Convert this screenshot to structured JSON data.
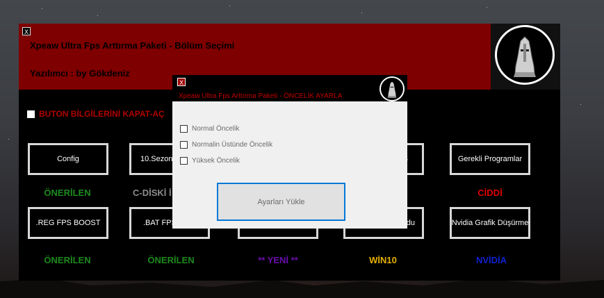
{
  "main_window": {
    "close_label": "X",
    "title": "Xpeaw Ultra Fps Arttırma Paketi - Bölüm Seçimi",
    "author": "Yazılımcı : by Gökdeniz",
    "toggle_label": "BUTON BİLGİLERİNİ KAPAT-AÇ",
    "buttons_row1": [
      "Config",
      "10.Sezon",
      "",
      "S",
      "Gerekli Programlar"
    ],
    "tags_row1": [
      {
        "text": "ÖNERİLEN",
        "color": "#1d8a1d"
      },
      {
        "text": "C-DİSKİ İ",
        "color": "#8c8c8c"
      },
      {
        "text": "",
        "color": "#000000"
      },
      {
        "text": "",
        "color": "#000000"
      },
      {
        "text": "CİDDİ",
        "color": "#e00000"
      }
    ],
    "buttons_row2": [
      ".REG FPS BOOST",
      ".BAT FPS",
      "",
      "du",
      "Nvidia Grafik Düşürme"
    ],
    "tags_row2": [
      {
        "text": "ÖNERİLEN",
        "color": "#1d8a1d"
      },
      {
        "text": "ÖNERİLEN",
        "color": "#1d8a1d"
      },
      {
        "text": "** YENİ **",
        "color": "#6a0dad"
      },
      {
        "text": "WİN10",
        "color": "#e5b000"
      },
      {
        "text": "NVİDİA",
        "color": "#1020d0"
      }
    ]
  },
  "dialog": {
    "close_label": "X",
    "title": "Xpeaw Ultra Fps Arttırma Paketi - ÖNCELİK AYARLA",
    "options": [
      "Normal Öncelik",
      "Normalin Üstünde Öncelik",
      "Yüksek Öncelik"
    ],
    "load_button": "Ayarları Yükle"
  }
}
